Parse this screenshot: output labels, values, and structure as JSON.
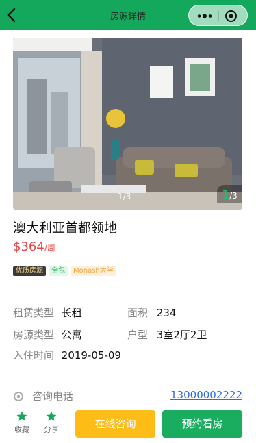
{
  "nav": {
    "title": "房源详情"
  },
  "gallery": {
    "counter_left": "1/3",
    "current": "1",
    "total": "/3"
  },
  "house": {
    "title": "澳大利亚首都领地",
    "price": "$364",
    "price_unit": "/周",
    "tags": [
      "优质房源",
      "全包",
      "Monash大学"
    ]
  },
  "details": {
    "rent_type_label": "租赁类型",
    "rent_type": "长租",
    "area_label": "面积",
    "area": "234",
    "house_type_label": "房源类型",
    "house_type": "公寓",
    "layout_label": "户型",
    "layout": "3室2厅2卫",
    "move_in_label": "入住时间",
    "move_in": "2019-05-09"
  },
  "contact": {
    "label": "咨询电话",
    "phone": "13000002222"
  },
  "bottom": {
    "collect": "收藏",
    "share": "分享",
    "consult": "在线咨询",
    "book": "预约看房"
  },
  "colors": {
    "brand_green": "#14a85c",
    "price_red": "#e64343",
    "consult_yellow": "#fdbc16",
    "link_blue": "#2d6fd6"
  },
  "icons": {
    "back": "back-chevron-icon",
    "more": "more-dots-icon",
    "close": "close-circle-icon",
    "phone": "phone-icon",
    "collect": "star-icon",
    "share": "star-icon"
  }
}
